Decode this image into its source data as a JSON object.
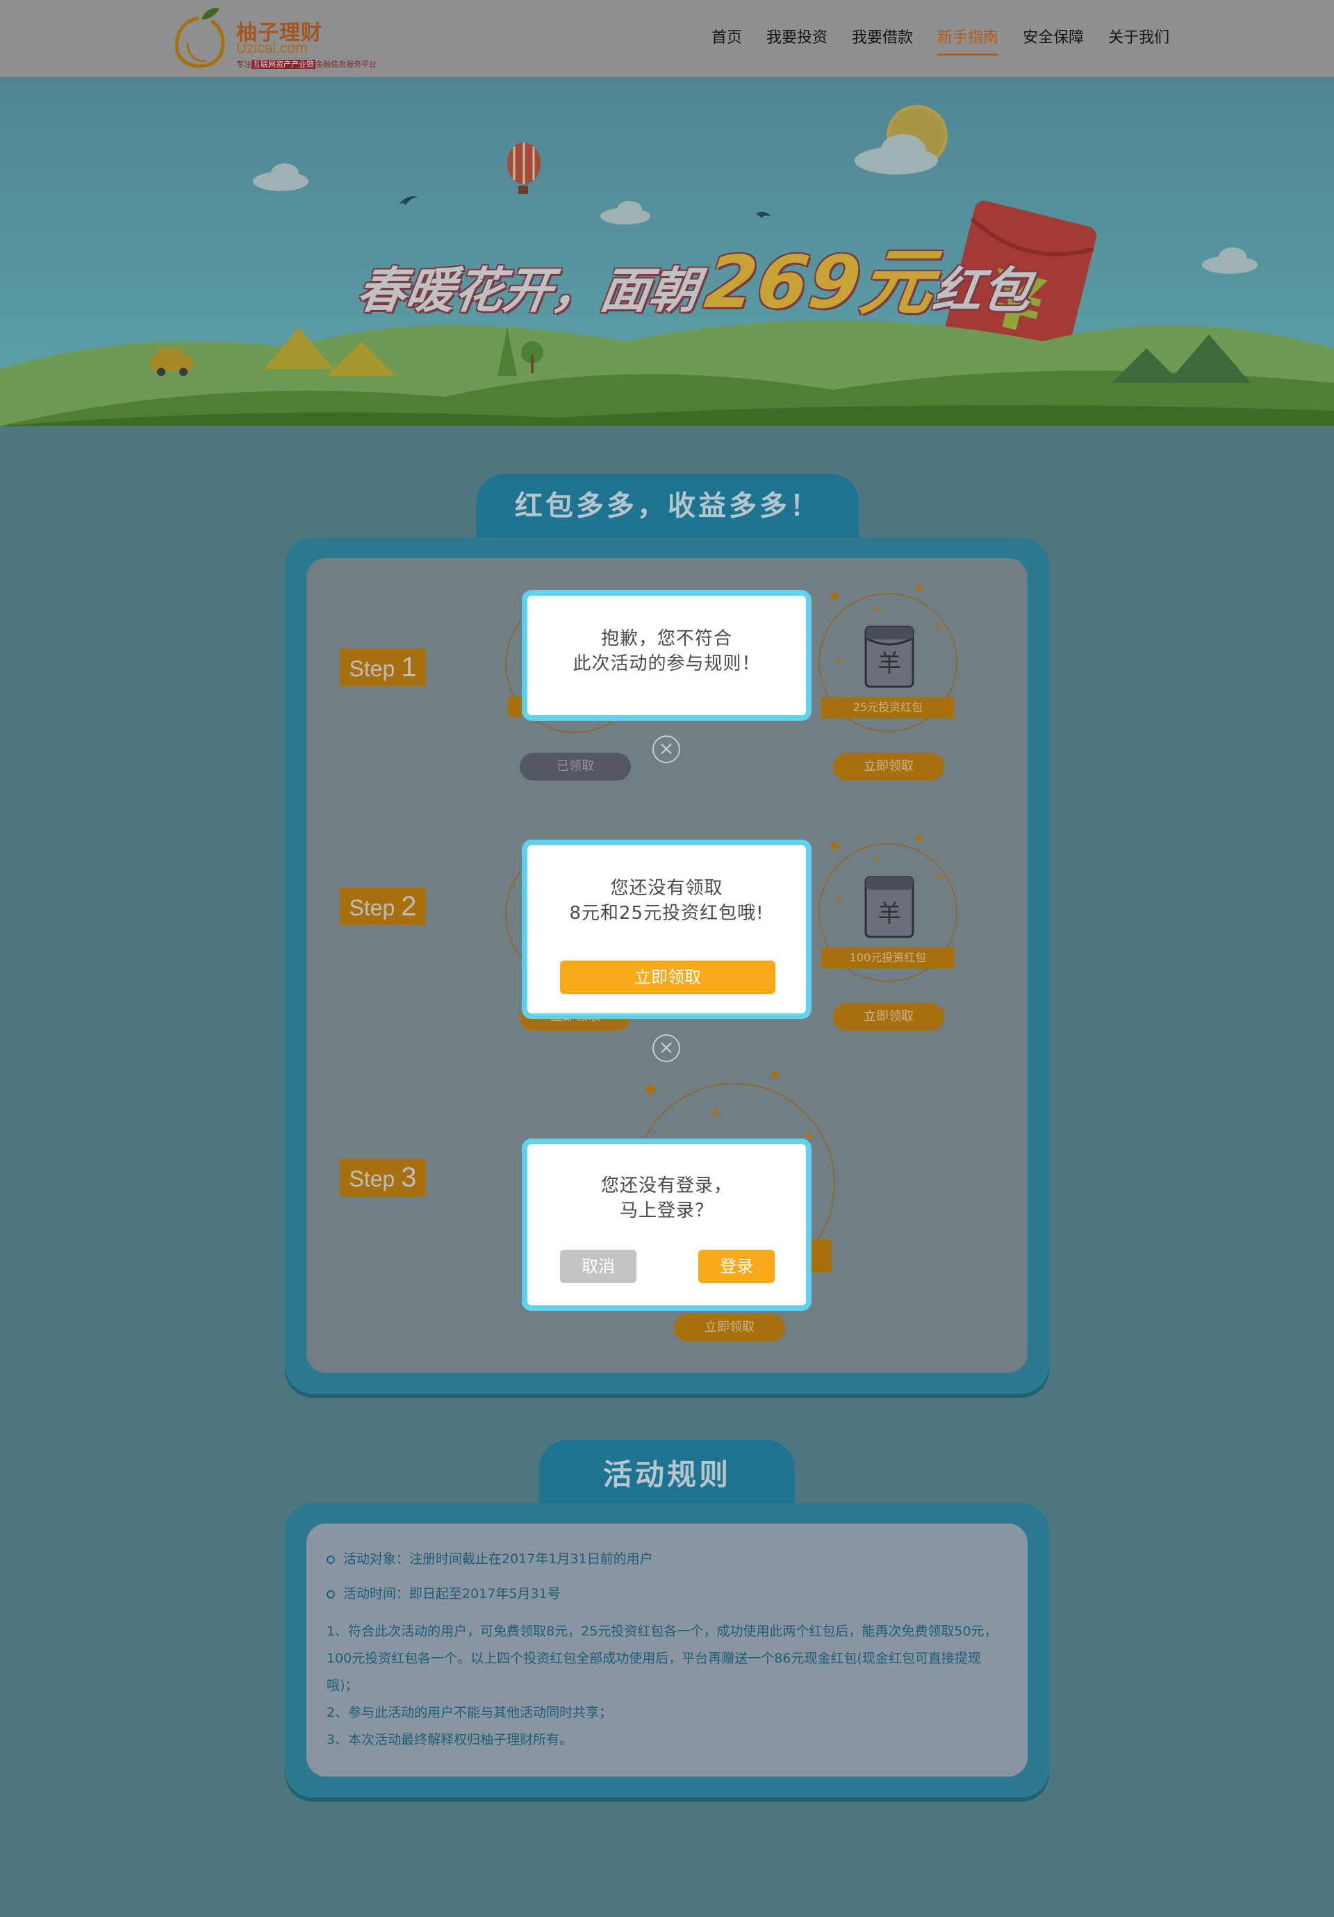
{
  "header": {
    "logo_name": "柚子理财",
    "logo_domain": "Uzicai.com",
    "tagline_prefix": "专注",
    "tagline_highlight": "互联网资产产业链",
    "tagline_suffix": "金融信息服务平台",
    "nav": [
      "首页",
      "我要投资",
      "我要借款",
      "新手指南",
      "安全保障",
      "关于我们"
    ],
    "active_nav": "新手指南"
  },
  "banner": {
    "title_a": "春暖花开，面朝",
    "title_b": "269元",
    "title_c": "红包"
  },
  "section1": {
    "heading": "红包多多，收益多多！",
    "steps": [
      {
        "tag": "Step",
        "num": "1",
        "left_button": "已领取",
        "right_label": "25元投资红包",
        "right_button": "立即领取"
      },
      {
        "tag": "Step",
        "num": "2",
        "left_button": "立即领取",
        "right_label": "100元投资红包",
        "right_button": "立即领取"
      },
      {
        "tag": "Step",
        "num": "3",
        "center_button": "立即领取"
      }
    ]
  },
  "dialogs": {
    "d1": {
      "line1": "抱歉，您不符合",
      "line2": "此次活动的参与规则！"
    },
    "d2": {
      "line1": "您还没有领取",
      "line2": "8元和25元投资红包哦!",
      "button": "立即领取"
    },
    "d3": {
      "line1": "您还没有登录，",
      "line2": "马上登录？",
      "cancel": "取消",
      "login": "登录"
    }
  },
  "section2": {
    "heading": "活动规则",
    "bullets": [
      "活动对象：注册时间截止在2017年1月31日前的用户",
      "活动时间：即日起至2017年5月31号"
    ],
    "rules": [
      "1、符合此次活动的用户，可免费领取8元，25元投资红包各一个，成功使用此两个红包后，能再次免费领取50元，100元投资红包各一个。以上四个投资红包全部成功使用后，平台再赠送一个86元现金红包(现金红包可直接提现哦)；",
      "2、参与此活动的用户不能与其他活动同时共享；",
      "3、本次活动最终解释权归柚子理财所有。"
    ]
  },
  "colors": {
    "overlay_bg": "#4e7680",
    "dialog_border": "#5fd2ef",
    "accent_orange": "#f8a919",
    "active_nav": "#b35d17"
  },
  "icons": [
    "logo-icon",
    "balloon-icon",
    "bird-icon",
    "cloud-icon",
    "sun-icon",
    "red-envelope-icon",
    "yuan-envelope-icon",
    "close-icon",
    "car-icon"
  ]
}
